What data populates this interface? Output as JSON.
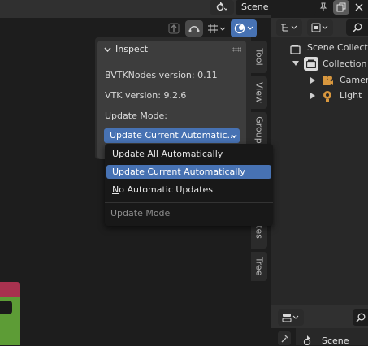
{
  "topbar": {
    "scene_name": "Scene",
    "icons": [
      "scene-icon",
      "pin-icon",
      "copy-icon",
      "close-icon"
    ]
  },
  "editor_header": {
    "icons": [
      "parent-icon",
      "curve-icon",
      "grid-snap-icon",
      "overlay-icon"
    ]
  },
  "panel": {
    "title": "Inspect",
    "bvtk_version": "BVTKNodes version: 0.11",
    "vtk_version": "VTK version: 9.2.6",
    "update_mode_label": "Update Mode:",
    "selected_value": "Update Current Automatic..."
  },
  "dropdown": {
    "options": [
      {
        "label": "Update All Automatically",
        "mnemonic": "U",
        "rest": "pdate All Automatically"
      },
      {
        "label": "Update Current Automatically",
        "mnemonic": "",
        "rest": "Update Current Automatically"
      },
      {
        "label": "No Automatic Updates",
        "mnemonic": "N",
        "rest": "o Automatic Updates"
      }
    ],
    "footer": "Update Mode"
  },
  "side_tabs": [
    "Tool",
    "View",
    "Group",
    "ites",
    "Tree"
  ],
  "outliner": {
    "items": [
      {
        "label": "Scene Collection",
        "icon": "scene-collection-icon"
      },
      {
        "label": "Collection",
        "icon": "collection-icon"
      },
      {
        "label": "Camera",
        "icon": "camera-icon"
      },
      {
        "label": "Light",
        "icon": "light-icon"
      }
    ]
  },
  "properties": {
    "scene_label": "Scene"
  },
  "colors": {
    "accent": "#4772b3",
    "panel_bg": "#3d3d3d",
    "menu_bg": "#181818",
    "node_header": "#a8324f",
    "node_body": "#5d9c36"
  }
}
